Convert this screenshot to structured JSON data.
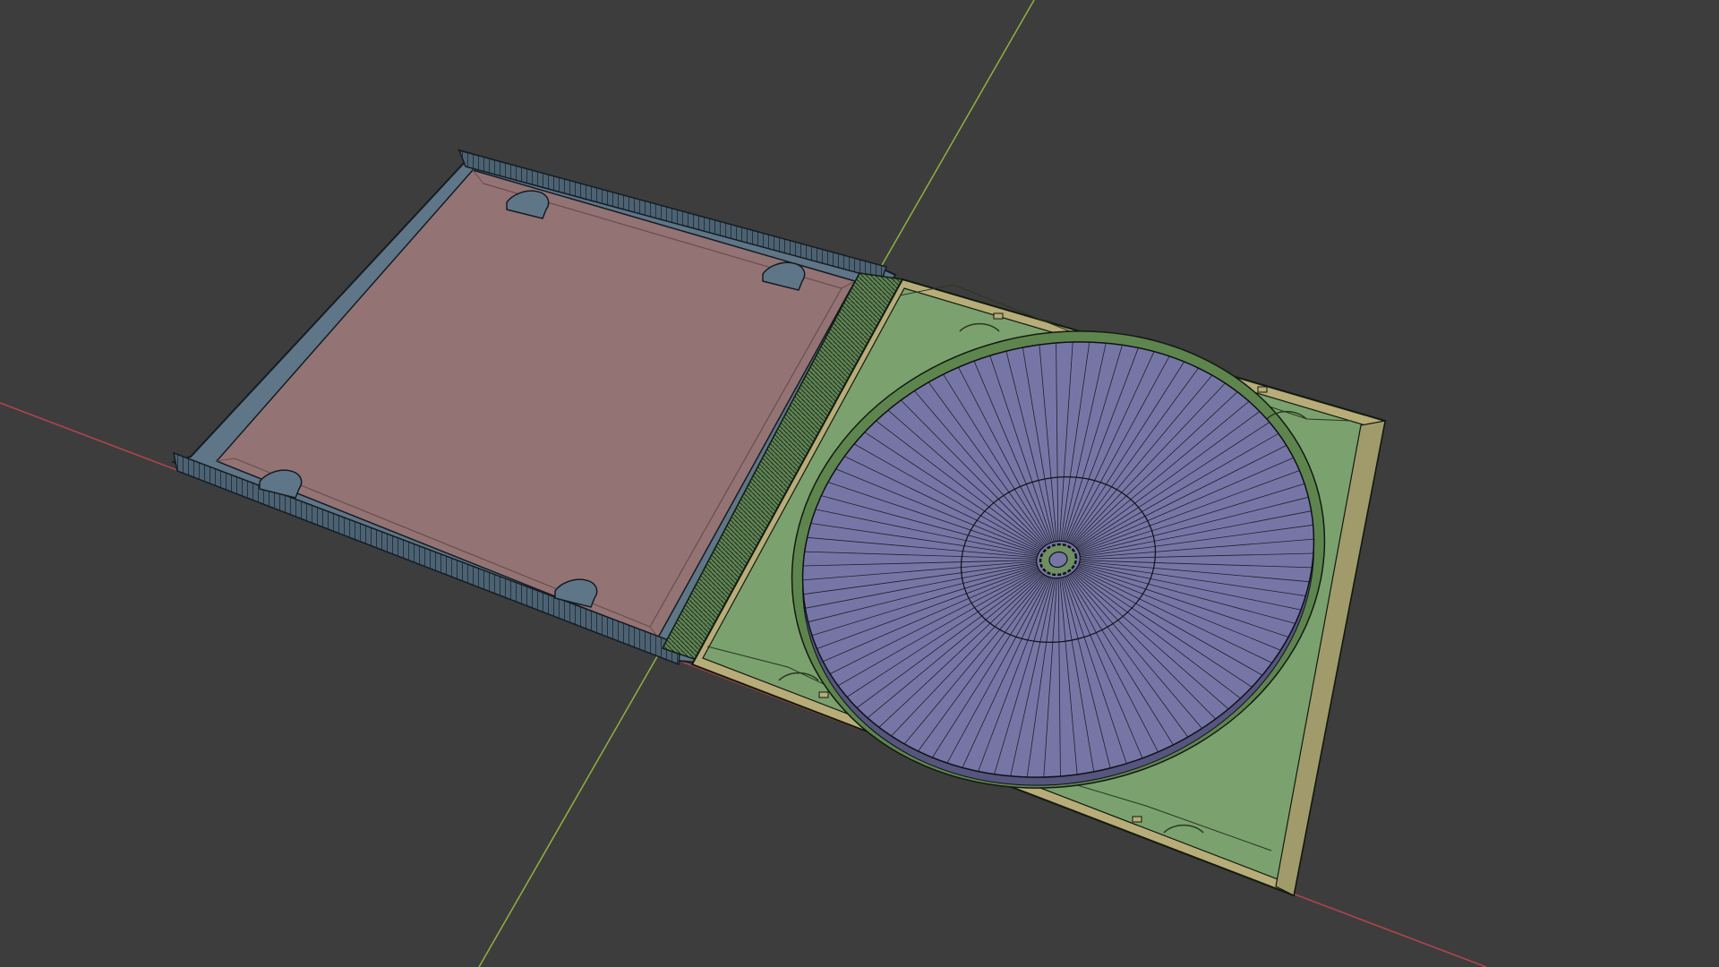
{
  "viewport": {
    "background": "#3d3d3d",
    "axes": {
      "x_axis_color": "#b5454e",
      "y_axis_color": "#8fb13f"
    }
  },
  "scene": {
    "objects": [
      {
        "name": "cd-case-lid",
        "fill": "#947374",
        "edge_color": "#141c22",
        "frame_color": "#5f7688"
      },
      {
        "name": "cd-case-hinge",
        "fill": "#6c8e59",
        "edge_color": "#111a10"
      },
      {
        "name": "cd-tray",
        "fill": "#7ba16f",
        "edge_color": "#111a10",
        "rim_color": "#b8ac78"
      },
      {
        "name": "cd-disc",
        "fill": "#7676a6",
        "edge_color": "#101018",
        "radial_segments": 96
      }
    ]
  }
}
